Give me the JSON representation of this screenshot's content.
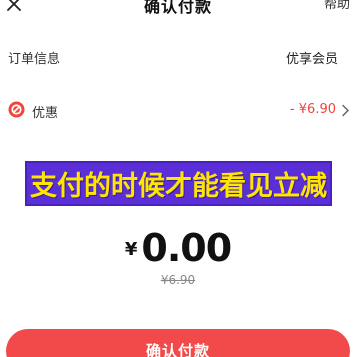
{
  "header": {
    "title": "确认付款",
    "help_label": "帮助",
    "close_icon": "close-icon"
  },
  "order": {
    "label": "订单信息",
    "value": "优享会员"
  },
  "discount": {
    "icon": "coupon-icon",
    "label": "优惠",
    "value": "- ¥6.90",
    "chevron_icon": "chevron-right-icon"
  },
  "banner": {
    "text": "支付的时候才能看见立减",
    "background": "#5b2fd8",
    "text_color": "#ffe600"
  },
  "payment": {
    "currency": "¥",
    "amount": "0.00",
    "original_price": "¥6.90"
  },
  "confirm_button": {
    "label": "确认付款",
    "color": "#f24a4a"
  },
  "colors": {
    "accent": "#f0453a"
  }
}
